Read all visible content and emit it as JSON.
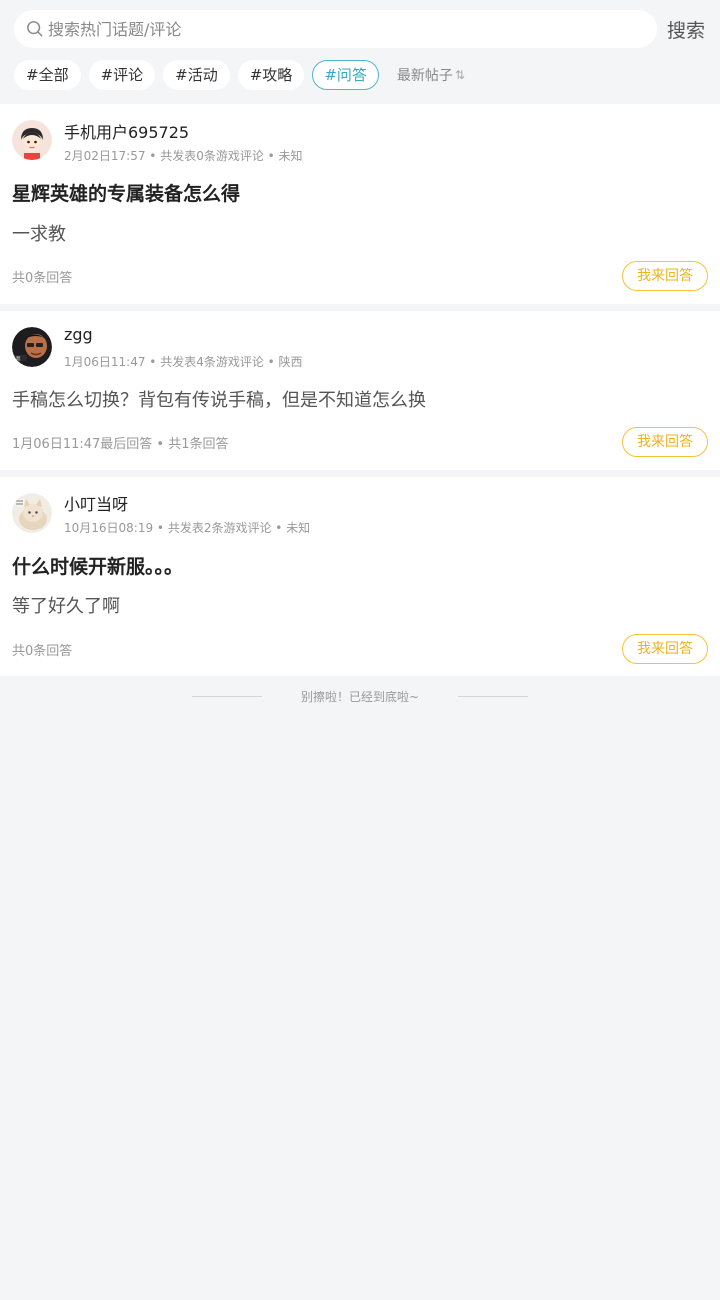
{
  "search": {
    "placeholder": "搜索热门话题/评论",
    "button": "搜索"
  },
  "tags": [
    "#全部",
    "#评论",
    "#活动",
    "#攻略",
    "#问答"
  ],
  "active_tag_index": 4,
  "sort_label": "最新帖子",
  "sort_icon": "⇅",
  "posts": [
    {
      "username": "手机用户695725",
      "meta": "2月02日17:57 • 共发表0条游戏评论 • 未知",
      "title": "星辉英雄的专属装备怎么得",
      "body": "一求教",
      "footer": "共0条回答",
      "answer_label": "我来回答"
    },
    {
      "username": "zgg",
      "meta": "1月06日11:47 • 共发表4条游戏评论 • 陕西",
      "title": "",
      "body": "手稿怎么切换？背包有传说手稿，但是不知道怎么换",
      "footer": "1月06日11:47最后回答 • 共1条回答",
      "answer_label": "我来回答"
    },
    {
      "username": "小叮当呀",
      "meta": "10月16日08:19 • 共发表2条游戏评论 • 未知",
      "title": "什么时候开新服。。。",
      "body": "等了好久了啊",
      "footer": "共0条回答",
      "answer_label": "我来回答"
    }
  ],
  "end_text": "别擦啦！已经到底啦~",
  "colors": {
    "accent": "#3aa9bd",
    "answer": "#eeb21d",
    "background": "#f4f5f7"
  }
}
